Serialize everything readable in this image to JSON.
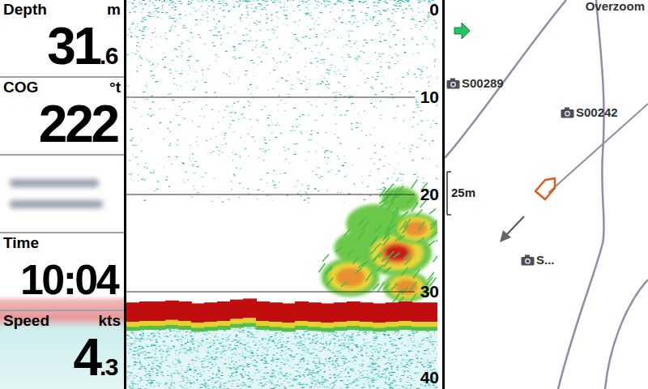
{
  "readouts": [
    {
      "kind": "number",
      "label": "Depth",
      "unit": "m",
      "value": "31",
      "decimal": ".6"
    },
    {
      "kind": "number",
      "label": "COG",
      "unit": "°t",
      "value": "222",
      "decimal": ""
    },
    {
      "kind": "blurred",
      "label": "",
      "unit": "",
      "value": "",
      "decimal": ""
    },
    {
      "kind": "number",
      "label": "Time",
      "unit": "",
      "value": "10:04",
      "decimal": ""
    },
    {
      "kind": "number",
      "label": "Speed",
      "unit": "kts",
      "value": "4",
      "decimal": ".3"
    }
  ],
  "sonar": {
    "scale": [
      "0",
      "10",
      "20",
      "30",
      "40"
    ],
    "bottom_depth": [
      31.1,
      31.0,
      31.0,
      30.9,
      31.0,
      31.2,
      31.1,
      31.0,
      30.8,
      30.7,
      31.0,
      31.1,
      31.2,
      31.0,
      31.1,
      31.2,
      31.1,
      31.0,
      31.1,
      31.2,
      31.1,
      31.0,
      31.1,
      31.1
    ],
    "targets": [
      {
        "x": 0.88,
        "depth": 20.5,
        "size": 1.6,
        "level": 0.45
      },
      {
        "x": 0.8,
        "depth": 23,
        "size": 2.5,
        "level": 0.4
      },
      {
        "x": 0.75,
        "depth": 25.5,
        "size": 2.2,
        "level": 0.35
      },
      {
        "x": 0.87,
        "depth": 26,
        "size": 3,
        "level": 0.92
      },
      {
        "x": 0.93,
        "depth": 23.5,
        "size": 2,
        "level": 0.7
      },
      {
        "x": 0.72,
        "depth": 28.5,
        "size": 2.5,
        "level": 0.65
      },
      {
        "x": 0.9,
        "depth": 29.5,
        "size": 2,
        "level": 0.65
      }
    ]
  },
  "map": {
    "label": "Overzoom",
    "scale": "25m",
    "waypoints": [
      {
        "label": "S00289"
      },
      {
        "label": "S00242"
      },
      {
        "label": "S..."
      }
    ]
  }
}
